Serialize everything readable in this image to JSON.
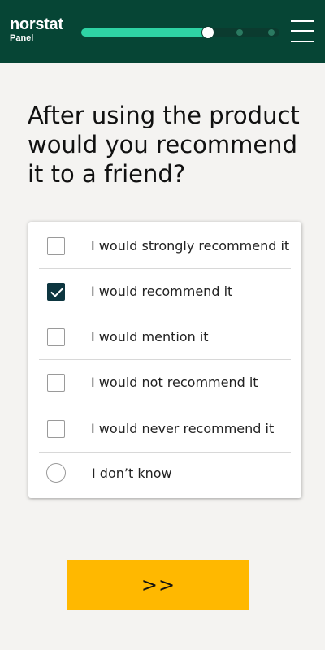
{
  "header": {
    "brand": "norstat",
    "brand_sub": "Panel",
    "progress": 0.64,
    "progress_steps": [
      0.8,
      0.96
    ],
    "colors": {
      "background": "#064535",
      "progress": "#2ed3a4"
    },
    "menu_icon": "hamburger-menu-icon"
  },
  "question": {
    "text": "After using the product would you recommend it to a friend?"
  },
  "options": [
    {
      "label": "I would strongly recommend it",
      "type": "checkbox",
      "checked": false
    },
    {
      "label": "I would recommend it",
      "type": "checkbox",
      "checked": true
    },
    {
      "label": "I would mention it",
      "type": "checkbox",
      "checked": false
    },
    {
      "label": "I would not recommend it",
      "type": "checkbox",
      "checked": false
    },
    {
      "label": "I would never recommend it",
      "type": "checkbox",
      "checked": false
    },
    {
      "label": "I don’t know",
      "type": "radio",
      "checked": false
    }
  ],
  "next_button": {
    "label": ">>",
    "color": "#ffb800"
  }
}
